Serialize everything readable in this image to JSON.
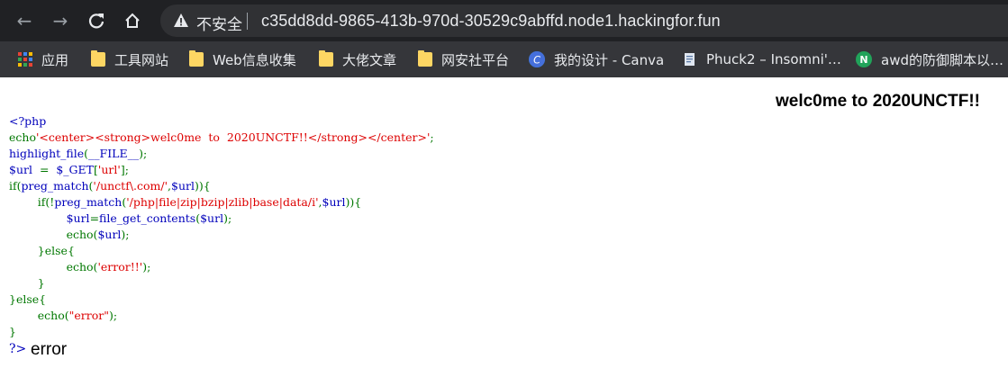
{
  "browser": {
    "insecure_label": "不安全",
    "url": "c35dd8dd-9865-413b-970d-30529c9abffd.node1.hackingfor.fun",
    "bookmarks": [
      {
        "label": "应用",
        "icon": "apps-grid-icon"
      },
      {
        "label": "工具网站",
        "icon": "folder-icon"
      },
      {
        "label": "Web信息收集",
        "icon": "folder-icon"
      },
      {
        "label": "大佬文章",
        "icon": "folder-icon"
      },
      {
        "label": "网安社平台",
        "icon": "folder-icon"
      },
      {
        "label": "我的设计 - Canva",
        "icon": "canva-icon"
      },
      {
        "label": "Phuck2 – Insomni'…",
        "icon": "document-icon"
      },
      {
        "label": "awd的防御脚本以…",
        "icon": "n-logo-icon"
      }
    ]
  },
  "page": {
    "welcome": "welc0me to 2020UNCTF!!",
    "code_lines": [
      [
        {
          "t": "<?php",
          "c": "def"
        }
      ],
      [
        {
          "t": "echo",
          "c": "kw"
        },
        {
          "t": "'<center><strong>welc0me  to  2020UNCTF!!</strong></center>'",
          "c": "str"
        },
        {
          "t": ";",
          "c": "kw"
        }
      ],
      [
        {
          "t": "highlight_file",
          "c": "def"
        },
        {
          "t": "(",
          "c": "kw"
        },
        {
          "t": "__FILE__",
          "c": "def"
        },
        {
          "t": ");",
          "c": "kw"
        }
      ],
      [
        {
          "t": "$url  ",
          "c": "def"
        },
        {
          "t": "=  ",
          "c": "kw"
        },
        {
          "t": "$_GET",
          "c": "def"
        },
        {
          "t": "[",
          "c": "kw"
        },
        {
          "t": "'url'",
          "c": "str"
        },
        {
          "t": "];",
          "c": "kw"
        }
      ],
      [
        {
          "t": "if(",
          "c": "kw"
        },
        {
          "t": "preg_match",
          "c": "def"
        },
        {
          "t": "(",
          "c": "kw"
        },
        {
          "t": "'/unctf\\.com/'",
          "c": "str"
        },
        {
          "t": ",",
          "c": "kw"
        },
        {
          "t": "$url",
          "c": "def"
        },
        {
          "t": ")){",
          "c": "kw"
        }
      ],
      [
        {
          "t": "        if(!",
          "c": "kw"
        },
        {
          "t": "preg_match",
          "c": "def"
        },
        {
          "t": "(",
          "c": "kw"
        },
        {
          "t": "'/php|file|zip|bzip|zlib|base|data/i'",
          "c": "str"
        },
        {
          "t": ",",
          "c": "kw"
        },
        {
          "t": "$url",
          "c": "def"
        },
        {
          "t": ")){",
          "c": "kw"
        }
      ],
      [
        {
          "t": "                ",
          "c": "kw"
        },
        {
          "t": "$url",
          "c": "def"
        },
        {
          "t": "=",
          "c": "kw"
        },
        {
          "t": "file_get_contents",
          "c": "def"
        },
        {
          "t": "(",
          "c": "kw"
        },
        {
          "t": "$url",
          "c": "def"
        },
        {
          "t": ");",
          "c": "kw"
        }
      ],
      [
        {
          "t": "                echo(",
          "c": "kw"
        },
        {
          "t": "$url",
          "c": "def"
        },
        {
          "t": ");",
          "c": "kw"
        }
      ],
      [
        {
          "t": "        }else{",
          "c": "kw"
        }
      ],
      [
        {
          "t": "                echo(",
          "c": "kw"
        },
        {
          "t": "'error!!'",
          "c": "str"
        },
        {
          "t": ");",
          "c": "kw"
        }
      ],
      [
        {
          "t": "        }",
          "c": "kw"
        }
      ],
      [
        {
          "t": "}else{",
          "c": "kw"
        }
      ],
      [
        {
          "t": "        echo(",
          "c": "kw"
        },
        {
          "t": "\"error\"",
          "c": "str"
        },
        {
          "t": ");",
          "c": "kw"
        }
      ],
      [
        {
          "t": "}",
          "c": "kw"
        }
      ]
    ],
    "php_close": "?>",
    "output": "error"
  },
  "colors": {
    "chrome_bg": "#202124",
    "omnibox_bg": "#303134",
    "bookmarks_bg": "#35363a",
    "php_default": "#0000BB",
    "php_keyword": "#007700",
    "php_string": "#DD0000"
  }
}
